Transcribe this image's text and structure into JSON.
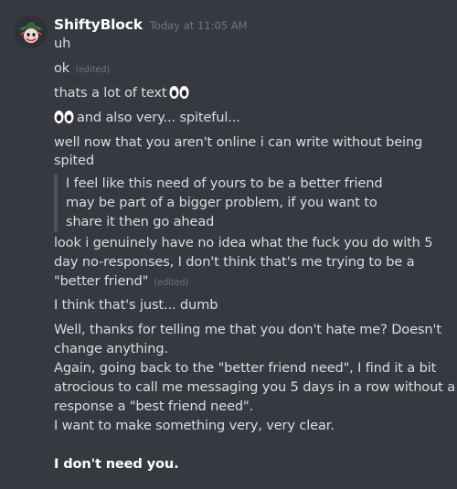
{
  "message": {
    "author": "ShiftyBlock",
    "timestamp": "Today at 11:05 AM",
    "edited_label": "(edited)",
    "lines": [
      "uh",
      "ok",
      "thats a lot of text",
      "and also very... spiteful...",
      "well now that you aren't online i can write without being",
      "spited",
      "I feel like this need of yours to be a better friend",
      "may be part of a bigger problem, if you want to",
      "share it then go ahead",
      "look i genuinely have no idea what the fuck you do with 5",
      "day no-responses, I don't think that's me trying to be a",
      "\"better friend\"",
      "I think that's just... dumb",
      "Well, thanks for telling me that you don't hate me? Doesn't",
      "change anything.",
      "Again, going back to the \"better friend need\", I find it a bit",
      "atrocious to call me messaging you 5 days in a row without a",
      "response a \"best friend need\".",
      "I want to make something very, very clear.",
      "I don't need you."
    ]
  },
  "icons": {
    "avatar": "avatar-character-icon",
    "eyes": "eyes-emoji-icon"
  },
  "colors": {
    "background": "#36393f",
    "text": "#dcddde",
    "username": "#ffffff",
    "muted": "#72767d",
    "quote_bar": "#4f545c"
  }
}
